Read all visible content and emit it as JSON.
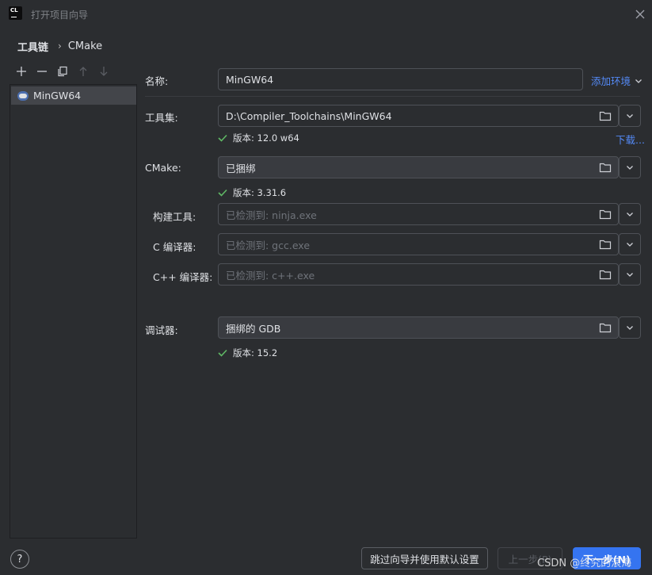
{
  "window": {
    "title": "打开项目向导"
  },
  "breadcrumb": {
    "first": "工具链",
    "separator": "›",
    "second": "CMake"
  },
  "toolbar": {
    "icons": [
      "add-icon",
      "remove-icon",
      "copy-icon",
      "move-up-icon",
      "move-down-icon"
    ]
  },
  "toolchains": [
    {
      "name": "MinGW64",
      "selected": true
    }
  ],
  "form": {
    "name_label": "名称:",
    "name_value": "MinGW64",
    "add_env_label": "添加环境",
    "toolset_label": "工具集:",
    "toolset_value": "D:\\Compiler_Toolchains\\MinGW64",
    "toolset_version": "版本: 12.0 w64",
    "download_link": "下载...",
    "cmake_label": "CMake:",
    "cmake_value": "已捆绑",
    "cmake_version": "版本: 3.31.6",
    "build_tool_label": "构建工具:",
    "build_tool_placeholder": "已检测到: ninja.exe",
    "c_compiler_label": "C 编译器:",
    "c_compiler_placeholder": "已检测到: gcc.exe",
    "cpp_compiler_label": "C++ 编译器:",
    "cpp_compiler_placeholder": "已检测到: c++.exe",
    "debugger_label": "调试器:",
    "debugger_value": "捆绑的 GDB",
    "debugger_version": "版本: 15.2"
  },
  "footer": {
    "help_label": "?",
    "skip_label": "跳过向导并使用默认设置",
    "prev_label": "上一步(P)",
    "next_label": "下一步(N)"
  },
  "watermark": "CSDN @终究的浪海",
  "colors": {
    "background": "#2b2d30",
    "accent": "#3574f0",
    "link": "#548af7",
    "check": "#5fb865"
  }
}
